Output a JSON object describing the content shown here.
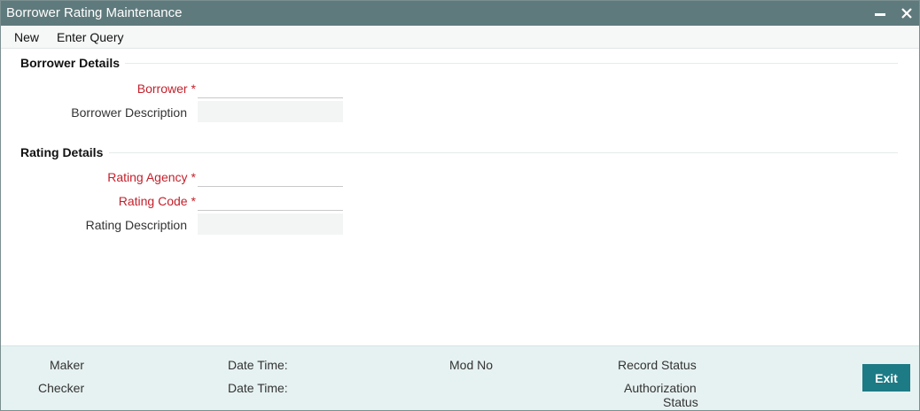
{
  "window": {
    "title": "Borrower Rating Maintenance",
    "minimize_icon": "minimize-icon",
    "close_icon": "close-icon"
  },
  "menu": {
    "new_label": "New",
    "enter_query_label": "Enter Query"
  },
  "borrower_section": {
    "title": "Borrower Details",
    "borrower_label": "Borrower",
    "borrower_value": "",
    "borrower_description_label": "Borrower Description",
    "borrower_description_value": ""
  },
  "rating_section": {
    "title": "Rating Details",
    "rating_agency_label": "Rating Agency",
    "rating_agency_value": "",
    "rating_code_label": "Rating Code",
    "rating_code_value": "",
    "rating_description_label": "Rating Description",
    "rating_description_value": ""
  },
  "required_marker": "*",
  "footer": {
    "maker_label": "Maker",
    "checker_label": "Checker",
    "date_time_label_1": "Date Time:",
    "date_time_label_2": "Date Time:",
    "mod_no_label": "Mod No",
    "record_status_label": "Record Status",
    "authorization_status_line1": "Authorization",
    "authorization_status_line2": "Status",
    "exit_label": "Exit"
  },
  "colors": {
    "titlebar": "#5f7a7c",
    "required": "#c5202b",
    "footer_bg": "#e6f2f1",
    "exit_button": "#1d7b85"
  }
}
